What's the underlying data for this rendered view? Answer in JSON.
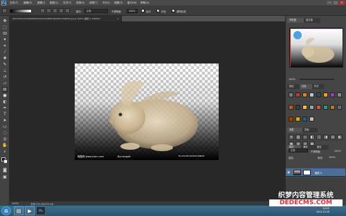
{
  "app": {
    "logo": "Ps"
  },
  "menubar": {
    "items": [
      "文件(F)",
      "编辑(E)",
      "图像(I)",
      "图层(L)",
      "文字(Y)",
      "选择(S)",
      "滤镜(T)",
      "3D(D)",
      "视图(V)",
      "窗口(W)",
      "帮助(H)"
    ],
    "window_controls": [
      "—",
      "□",
      "✕"
    ]
  },
  "options": {
    "mode_label": "模式:",
    "mode_value": "正常",
    "opacity_label": "不透明度:",
    "opacity_value": "100%",
    "reverse_label": "反向",
    "dither_label": "仿色",
    "transparency_label": "透明区域"
  },
  "document": {
    "tab_title": "a5c27d5ed72e5e64fef03de1fcde4f0f1d4a9f5dc0e8edb.jpg @ 100% (图层 0, RGB/8) *",
    "close": "×",
    "watermark_left": "昵图网 www.nipic.com",
    "watermark_id": "By:nengda",
    "watermark_right": "No:20120514105451288000"
  },
  "statusbar": {
    "zoom": "100%",
    "doc_info": "文档:370.4K/370.4K"
  },
  "panels": {
    "navigator_tab": "导航器",
    "histogram_tab": "直方图",
    "zoom_value": "100%",
    "color_tabs": [
      "颜色",
      "色板",
      "样式"
    ],
    "adjust_tabs": [
      "调整",
      "蒙版"
    ],
    "layers_tabs": [
      "图层",
      "通道",
      "路径"
    ],
    "layer_mode": "正常",
    "opacity_label": "不透明度:",
    "opacity_value": "100%",
    "lock_label": "锁定:",
    "fill_label": "填充:",
    "fill_value": "100%",
    "layer_name": "图层 0"
  },
  "taskbar": {
    "time": "14:22",
    "date": "2014-10-20"
  },
  "brand": {
    "line1": "织梦内容管理系统",
    "line2": "DEDECMS.COM"
  },
  "colors": {
    "accent": "#4c6f96",
    "ps_blue": "#5aa3d9",
    "nav_rect": "#e02020"
  },
  "icons": [
    "ps-logo",
    "move-tool-icon",
    "marquee-tool-icon",
    "lasso-tool-icon",
    "magic-wand-icon",
    "crop-tool-icon",
    "eyedropper-icon",
    "brush-tool-icon",
    "stamp-tool-icon",
    "eraser-icon",
    "gradient-tool-icon",
    "pen-tool-icon",
    "type-tool-icon",
    "hand-tool-icon",
    "zoom-tool-icon",
    "windows-start-icon"
  ]
}
